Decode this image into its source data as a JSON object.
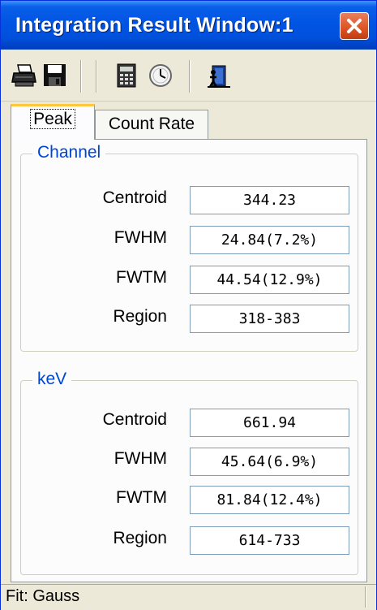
{
  "window": {
    "title": "Integration Result Window:1"
  },
  "toolbar": {
    "icons": [
      "printer-icon",
      "save-icon",
      "calculator-icon",
      "clock-icon",
      "exit-icon"
    ]
  },
  "tabs": [
    {
      "label": "Peak",
      "active": true
    },
    {
      "label": "Count Rate",
      "active": false
    }
  ],
  "channel": {
    "legend": "Channel",
    "rows": [
      {
        "label": "Centroid",
        "value": "344.23"
      },
      {
        "label": "FWHM",
        "value": "24.84(7.2%)"
      },
      {
        "label": "FWTM",
        "value": "44.54(12.9%)"
      },
      {
        "label": "Region",
        "value": "318-383"
      }
    ]
  },
  "kev": {
    "legend": "keV",
    "rows": [
      {
        "label": "Centroid",
        "value": "661.94"
      },
      {
        "label": "FWHM",
        "value": "45.64(6.9%)"
      },
      {
        "label": "FWTM",
        "value": "81.84(12.4%)"
      },
      {
        "label": "Region",
        "value": "614-733"
      }
    ]
  },
  "status": {
    "text": "Fit: Gauss"
  },
  "colors": {
    "titlebar": "#0054e3",
    "legend": "#0046d5",
    "close": "#e05a2a",
    "tab_highlight": "#ffc83c"
  }
}
